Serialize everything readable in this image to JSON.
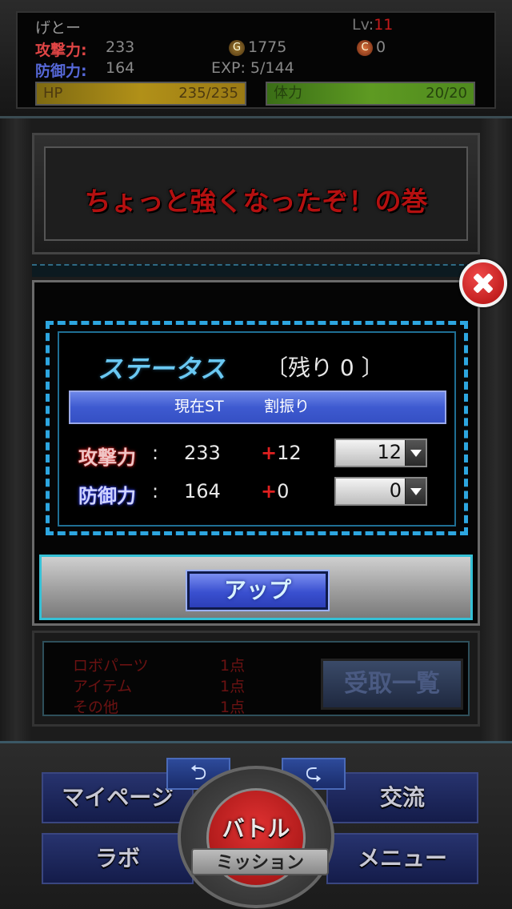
{
  "player": {
    "name": "げとー",
    "level_label": "Lv:",
    "level": "11",
    "attack_label": "攻撃力:",
    "attack": "233",
    "defense_label": "防御力:",
    "defense": "164",
    "gold_icon": "G",
    "gold": "1775",
    "coin_icon": "C",
    "coin": "0",
    "exp": "EXP: 5/144",
    "hp_label": "HP",
    "hp_value": "235/235",
    "stamina_label": "体力",
    "stamina_value": "20/20"
  },
  "quest": {
    "title": "ちょっと強くなったぞ！の巻"
  },
  "rewards": {
    "rows": [
      {
        "label": "ロボパーツ",
        "points": "1点"
      },
      {
        "label": "アイテム",
        "points": "1点"
      },
      {
        "label": "その他",
        "points": "1点"
      }
    ],
    "receive_button": "受取一覧"
  },
  "modal": {
    "title": "ステータス",
    "remaining": "〔残り 0 〕",
    "header_current": "現在ST",
    "header_alloc": "割振り",
    "attack_label": "攻撃力",
    "attack_value": "233",
    "attack_bonus": "12",
    "attack_select": "12",
    "defense_label": "防御力",
    "defense_value": "164",
    "defense_bonus": "0",
    "defense_select": "0",
    "colon": ":",
    "plus": "+",
    "up_button": "アップ"
  },
  "nav": {
    "mypage": "マイページ",
    "labo": "ラボ",
    "kouryu": "交流",
    "menu": "メニュー",
    "battle": "バトル",
    "mission": "ミッション",
    "arrow_left": "⮌",
    "arrow_right": "⮎"
  }
}
